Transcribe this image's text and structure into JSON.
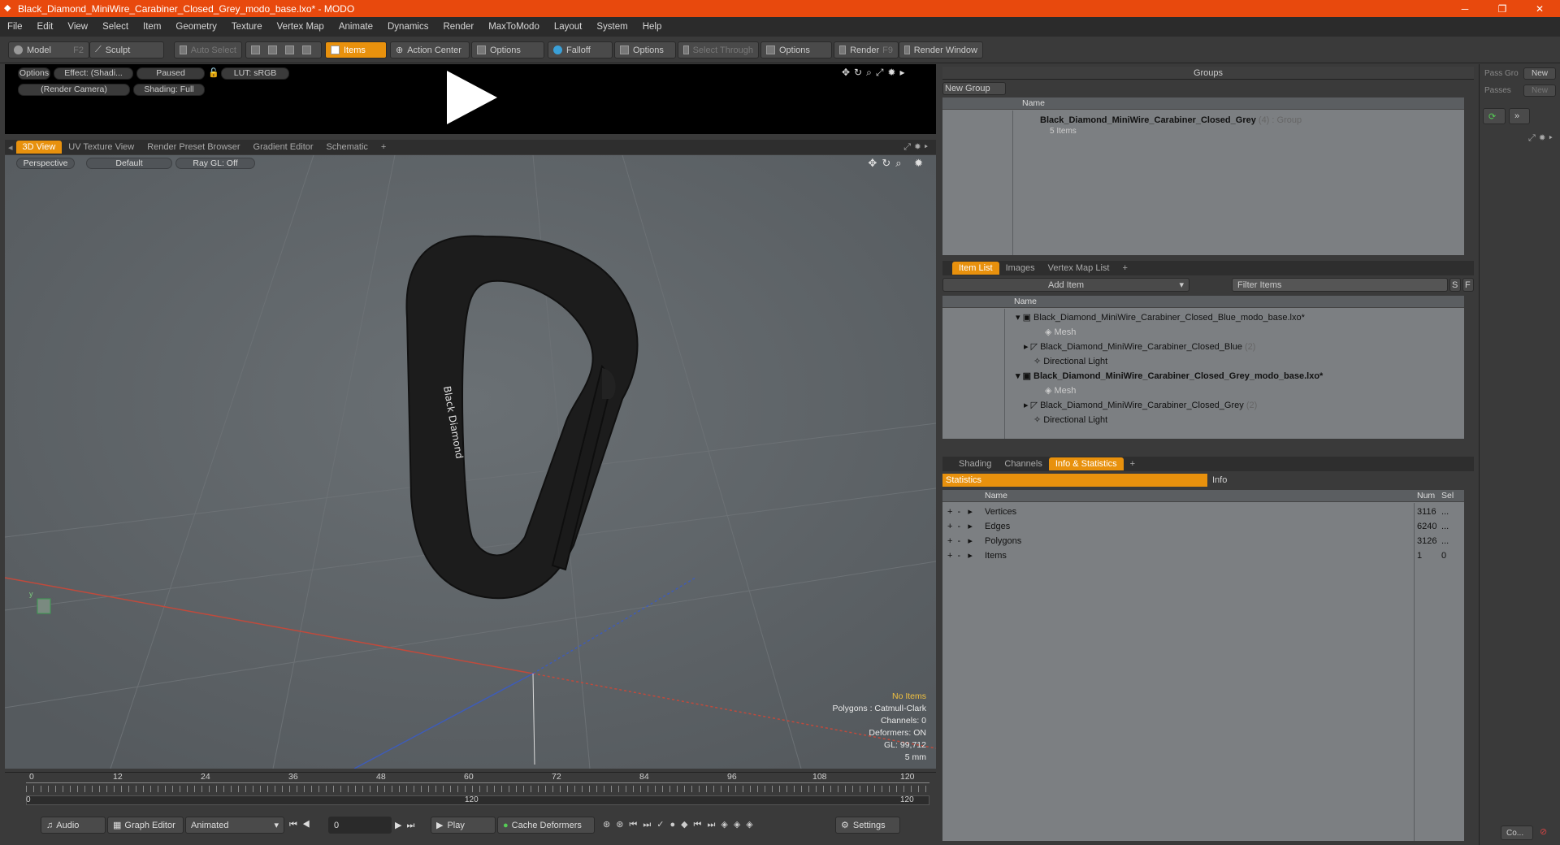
{
  "window": {
    "title": "Black_Diamond_MiniWire_Carabiner_Closed_Grey_modo_base.lxo* - MODO",
    "minimize": "─",
    "maximize": "❐",
    "close": "✕"
  },
  "menu": [
    "File",
    "Edit",
    "View",
    "Select",
    "Item",
    "Geometry",
    "Texture",
    "Vertex Map",
    "Animate",
    "Dynamics",
    "Render",
    "MaxToModo",
    "Layout",
    "System",
    "Help"
  ],
  "toolbar": {
    "model": "Model",
    "model_key": "F2",
    "sculpt": "Sculpt",
    "auto_select": "Auto Select",
    "items": "Items",
    "action_center": "Action Center",
    "options1": "Options",
    "falloff": "Falloff",
    "options2": "Options",
    "select_through": "Select Through",
    "options3": "Options",
    "render": "Render",
    "render_key": "F9",
    "render_window": "Render Window"
  },
  "preview": {
    "options": "Options",
    "effect": "Effect: (Shadi...",
    "paused": "Paused",
    "lut": "LUT: sRGB",
    "camera": "(Render Camera)",
    "shading": "Shading: Full"
  },
  "viewport_tabs": [
    "3D View",
    "UV Texture View",
    "Render Preset Browser",
    "Gradient Editor",
    "Schematic",
    "+"
  ],
  "viewport": {
    "perspective": "Perspective",
    "default": "Default",
    "raygl": "Ray GL: Off",
    "logo_text": "Black Diamond",
    "info": {
      "no_items": "No Items",
      "polygons": "Polygons : Catmull-Clark",
      "channels": "Channels: 0",
      "deformers": "Deformers: ON",
      "gl": "GL: 99,712",
      "scale": "5 mm"
    }
  },
  "timeline": {
    "ticks": [
      "0",
      "12",
      "24",
      "36",
      "48",
      "60",
      "72",
      "84",
      "96",
      "108",
      "120"
    ],
    "start": "0",
    "mid": "120",
    "end": "120"
  },
  "bottom": {
    "audio": "Audio",
    "graph_editor": "Graph Editor",
    "animated": "Animated",
    "frame": "0",
    "play": "Play",
    "cache": "Cache Deformers",
    "settings": "Settings"
  },
  "groups": {
    "header": "Groups",
    "new_group": "New Group",
    "col_name": "Name",
    "item_name": "Black_Diamond_MiniWire_Carabiner_Closed_Grey",
    "item_count": "(4)",
    "item_type": ": Group",
    "item_sub": "5 Items"
  },
  "itemlist": {
    "tabs": [
      "Item List",
      "Images",
      "Vertex Map List",
      "+"
    ],
    "add_item": "Add Item",
    "filter": "Filter Items",
    "s": "S",
    "f": "F",
    "col_name": "Name",
    "rows": [
      {
        "label": "Black_Diamond_MiniWire_Carabiner_Closed_Blue_modo_base.lxo*",
        "suffix": "",
        "bold": false,
        "dim": false,
        "indent": 0
      },
      {
        "label": "Mesh",
        "suffix": "",
        "bold": false,
        "dim": true,
        "indent": 2
      },
      {
        "label": "Black_Diamond_MiniWire_Carabiner_Closed_Blue",
        "suffix": "(2)",
        "bold": false,
        "dim": false,
        "indent": 1
      },
      {
        "label": "Directional Light",
        "suffix": "",
        "bold": false,
        "dim": false,
        "indent": 2
      },
      {
        "label": "Black_Diamond_MiniWire_Carabiner_Closed_Grey_modo_base.lxo*",
        "suffix": "",
        "bold": true,
        "dim": false,
        "indent": 0
      },
      {
        "label": "Mesh",
        "suffix": "",
        "bold": false,
        "dim": true,
        "indent": 2
      },
      {
        "label": "Black_Diamond_MiniWire_Carabiner_Closed_Grey",
        "suffix": "(2)",
        "bold": false,
        "dim": false,
        "indent": 1
      },
      {
        "label": "Directional Light",
        "suffix": "",
        "bold": false,
        "dim": false,
        "indent": 2
      }
    ]
  },
  "stats": {
    "tabs": [
      "Shading",
      "Channels",
      "Info & Statistics",
      "+"
    ],
    "statistics": "Statistics",
    "info": "Info",
    "col_name": "Name",
    "col_num": "Num",
    "col_sel": "Sel",
    "rows": [
      {
        "name": "Vertices",
        "num": "3116",
        "sel": "..."
      },
      {
        "name": "Edges",
        "num": "6240",
        "sel": "..."
      },
      {
        "name": "Polygons",
        "num": "3126",
        "sel": "..."
      },
      {
        "name": "Items",
        "num": "1",
        "sel": "0"
      }
    ]
  },
  "passes": {
    "pass_group": "Pass Gro",
    "new1": "New",
    "passes": "Passes",
    "new2": "New",
    "collapse": "Co..."
  }
}
